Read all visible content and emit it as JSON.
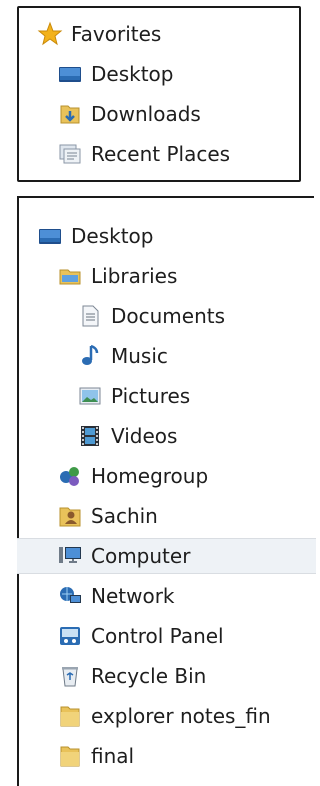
{
  "favorites": {
    "header": "Favorites",
    "items": [
      {
        "label": "Desktop",
        "icon": "desktop-icon"
      },
      {
        "label": "Downloads",
        "icon": "downloads-folder-icon"
      },
      {
        "label": "Recent Places",
        "icon": "recent-places-icon"
      }
    ]
  },
  "tree": {
    "items": [
      {
        "label": "Desktop",
        "icon": "desktop-icon"
      },
      {
        "label": "Libraries",
        "icon": "libraries-icon"
      },
      {
        "label": "Documents",
        "icon": "documents-icon"
      },
      {
        "label": "Music",
        "icon": "music-icon"
      },
      {
        "label": "Pictures",
        "icon": "pictures-icon"
      },
      {
        "label": "Videos",
        "icon": "videos-icon"
      },
      {
        "label": "Homegroup",
        "icon": "homegroup-icon"
      },
      {
        "label": "Sachin",
        "icon": "user-folder-icon"
      },
      {
        "label": "Computer",
        "icon": "computer-icon",
        "selected": true
      },
      {
        "label": "Network",
        "icon": "network-icon"
      },
      {
        "label": "Control Panel",
        "icon": "control-panel-icon"
      },
      {
        "label": "Recycle Bin",
        "icon": "recycle-bin-icon"
      },
      {
        "label": "explorer notes_fin",
        "icon": "folder-icon"
      },
      {
        "label": "final",
        "icon": "folder-icon"
      }
    ]
  },
  "colors": {
    "selection": "#eef2f6",
    "border": "#1a1a1a",
    "folder": "#e9c25a",
    "desktop_blue": "#2d6fb5"
  }
}
